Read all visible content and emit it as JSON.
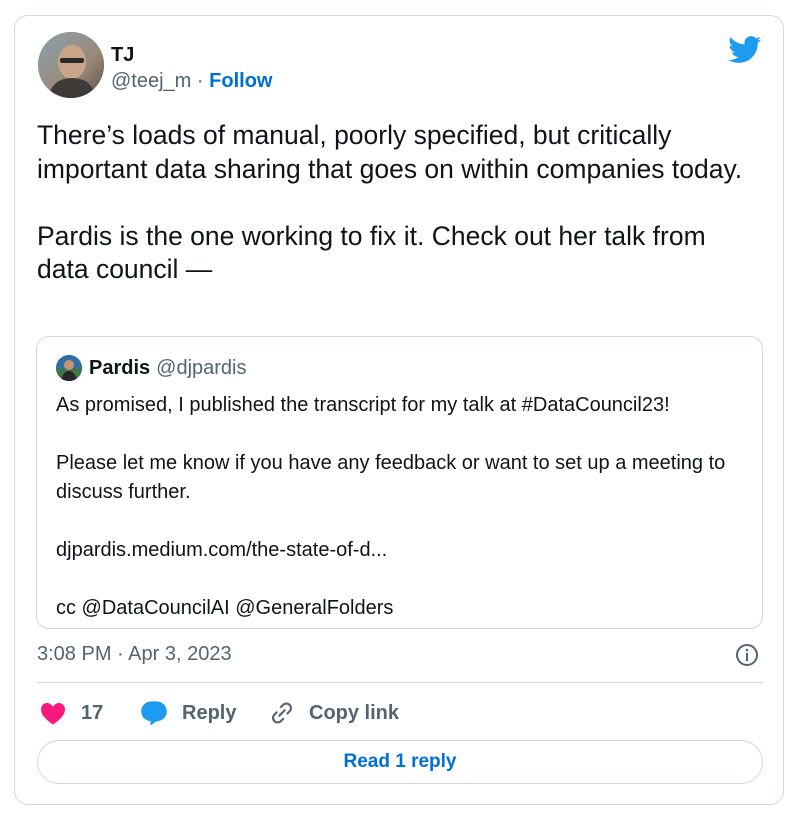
{
  "author": {
    "name": "TJ",
    "handle": "@teej_m",
    "separator": "·",
    "follow_label": "Follow"
  },
  "tweet": {
    "paragraphs": [
      "There’s loads of manual, poorly specified, but critically important data sharing that goes on within companies today.",
      "Pardis is the one working to fix it. Check out her talk from data council —"
    ]
  },
  "quote": {
    "name": "Pardis",
    "handle": "@djpardis",
    "paragraphs": [
      "As promised, I published the transcript for my talk at #DataCouncil23!",
      "Please let me know if you have any feedback or want to set up a meeting to discuss further.",
      "djpardis.medium.com/the-state-of-d...",
      "cc @DataCouncilAI @GeneralFolders"
    ]
  },
  "timestamp": "3:08 PM · Apr 3, 2023",
  "actions": {
    "like_count": "17",
    "reply_label": "Reply",
    "copy_label": "Copy link"
  },
  "read_replies_label": "Read 1 reply",
  "colors": {
    "accent": "#006fd6",
    "like": "#f91880",
    "twitter_blue": "#1d9bf0",
    "border": "#cfd9de",
    "muted": "#536471"
  },
  "icons": [
    "twitter-bird-icon",
    "info-icon",
    "heart-icon",
    "reply-bubble-icon",
    "link-icon"
  ]
}
